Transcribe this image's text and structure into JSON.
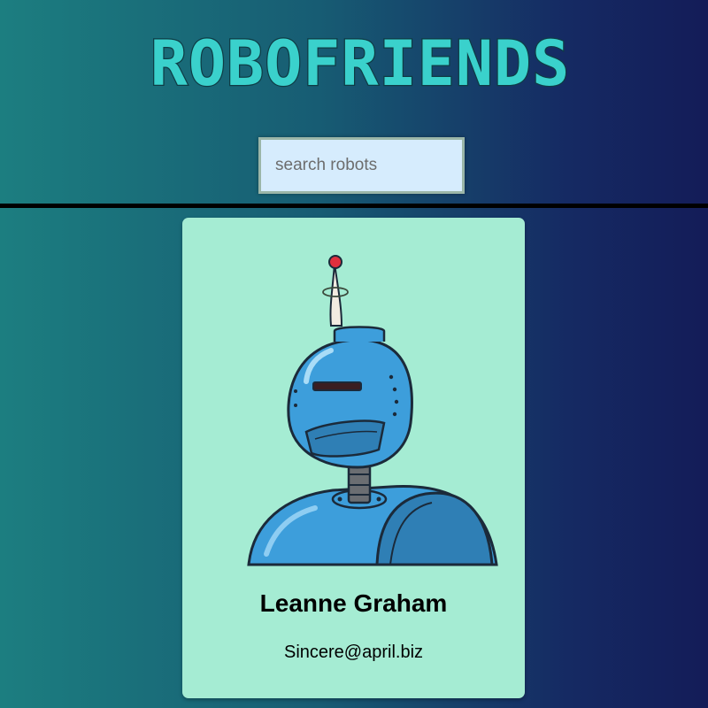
{
  "app": {
    "title": "ROBOFRIENDS"
  },
  "search": {
    "placeholder": "search robots",
    "value": ""
  },
  "robots": [
    {
      "name": "Leanne Graham",
      "email": "Sincere@april.biz",
      "avatar_icon": "robot-avatar-icon"
    }
  ],
  "colors": {
    "logo": "#3ad1cc",
    "logo_outline": "#0e3c45",
    "card_background": "#a5ecd3",
    "search_background": "#d6ecfd",
    "background_left": "#1c7e80",
    "background_right": "#141c58"
  }
}
